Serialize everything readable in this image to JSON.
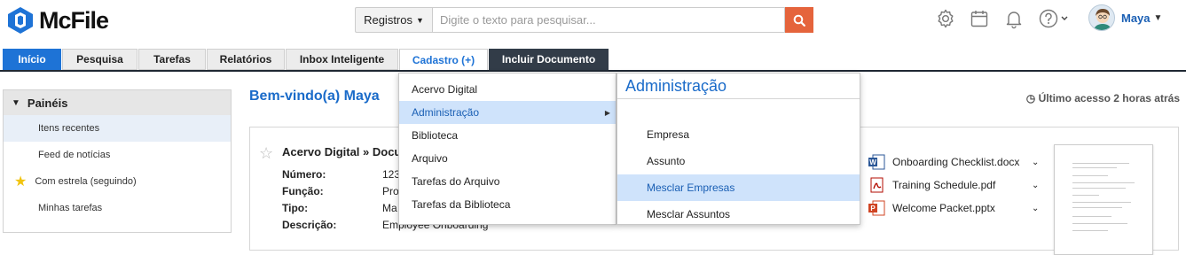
{
  "app": {
    "name": "McFile"
  },
  "search": {
    "category": "Registros",
    "placeholder": "Digite o texto para pesquisar..."
  },
  "user": {
    "name": "Maya"
  },
  "tabs": [
    {
      "label": "Início"
    },
    {
      "label": "Pesquisa"
    },
    {
      "label": "Tarefas"
    },
    {
      "label": "Relatórios"
    },
    {
      "label": "Inbox Inteligente"
    },
    {
      "label": "Cadastro (+)"
    },
    {
      "label": "Incluir Documento"
    }
  ],
  "panel": {
    "title": "Painéis",
    "items": [
      {
        "label": "Itens recentes"
      },
      {
        "label": "Feed de notícias"
      },
      {
        "label": "Com estrela (seguindo)"
      },
      {
        "label": "Minhas tarefas"
      }
    ]
  },
  "welcome": "Bem-vindo(a) Maya",
  "last_access": "Último acesso 2 horas atrás",
  "card": {
    "title": "Acervo Digital » Documento",
    "fields": [
      {
        "label": "Número:",
        "value": "123"
      },
      {
        "label": "Função:",
        "value": "Pro"
      },
      {
        "label": "Tipo:",
        "value": "Ma"
      },
      {
        "label": "Descrição:",
        "value": "Employee Onboarding"
      }
    ],
    "files": [
      {
        "name": "Onboarding Checklist.docx",
        "icon": "word-doc-icon"
      },
      {
        "name": "Training Schedule.pdf",
        "icon": "pdf-icon"
      },
      {
        "name": "Welcome Packet.pptx",
        "icon": "powerpoint-icon"
      }
    ]
  },
  "menu": {
    "items": [
      {
        "label": "Acervo Digital"
      },
      {
        "label": "Administração"
      },
      {
        "label": "Biblioteca"
      },
      {
        "label": "Arquivo"
      },
      {
        "label": "Tarefas do Arquivo"
      },
      {
        "label": "Tarefas da Biblioteca"
      }
    ]
  },
  "submenu": {
    "title": "Administração",
    "items": [
      {
        "label": "Empresa"
      },
      {
        "label": "Assunto"
      },
      {
        "label": "Mesclar Empresas"
      },
      {
        "label": "Mesclar Assuntos"
      }
    ]
  },
  "colors": {
    "accent": "#1e73d6",
    "search_button": "#e5643c",
    "dark_tab": "#323c48",
    "highlight": "#cfe3fb"
  }
}
